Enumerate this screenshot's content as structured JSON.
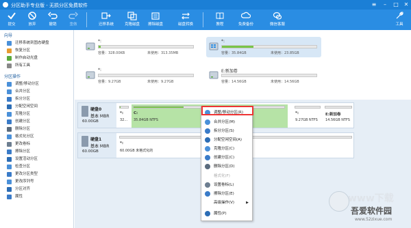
{
  "window": {
    "title": "分区助手专业版 - 无损分区免费软件"
  },
  "toolbar": {
    "buttons": [
      {
        "label": "提交",
        "enabled": true
      },
      {
        "label": "放弃",
        "enabled": true
      },
      {
        "label": "撤销",
        "enabled": true
      },
      {
        "label": "重做",
        "enabled": false
      },
      {
        "label": "迁移系统",
        "enabled": true
      },
      {
        "label": "克隆磁盘",
        "enabled": true
      },
      {
        "label": "擦除磁盘",
        "enabled": true
      },
      {
        "label": "磁盘转换",
        "enabled": true
      },
      {
        "label": "教程",
        "enabled": true
      },
      {
        "label": "免费备份",
        "enabled": true
      },
      {
        "label": "微信客服",
        "enabled": true
      },
      {
        "label": "工具",
        "enabled": true
      }
    ]
  },
  "sidebar": {
    "wizard_heading": "向导",
    "wizard_items": [
      "迁移系统到固态硬盘",
      "恢复分区",
      "制作启动光盘",
      "所有工具"
    ],
    "ops_heading": "分区操作",
    "ops_items": [
      "调整/移动分区",
      "合并分区",
      "拆分分区",
      "分配空闲空间",
      "克隆分区",
      "创建分区",
      "删除分区",
      "格式化分区",
      "更改卷标",
      "擦除分区",
      "设置活动分区",
      "检查分区",
      "更改分区类型",
      "更改序列号",
      "分区对齐",
      "属性"
    ]
  },
  "disk_cards": [
    {
      "label": "*:",
      "capacity": "容量：328.00KB",
      "free": "未使用：313.35MB",
      "fill": 0.02
    },
    {
      "label": "*:",
      "capacity": "容量：35.84GB",
      "free": "未使用：23.85GB",
      "fill": 0.33
    },
    {
      "label": "*:",
      "capacity": "容量：9.27GB",
      "free": "未使用：9.27GB",
      "fill": 0.0
    },
    {
      "label": "E:新加卷",
      "capacity": "容量：14.56GB",
      "free": "未使用：14.56GB",
      "fill": 0.0
    }
  ],
  "disk0": {
    "name": "硬盘0",
    "type": "基本 MBR",
    "size": "60.00GB",
    "partitions": [
      {
        "name": "*:",
        "info": "32...",
        "fill": 0.1
      },
      {
        "name": "C:",
        "info": "35.84GB NTFS",
        "fill": 0.33
      },
      {
        "name": "*:",
        "info": "9.27GB NTFS",
        "fill": 0.0
      },
      {
        "name": "E:新加卷",
        "info": "14.56GB NTFS",
        "fill": 0.0
      }
    ]
  },
  "disk1": {
    "name": "硬盘1",
    "type": "基本 MBR",
    "size": "60.00GB",
    "partitions": [
      {
        "name": "*:",
        "info": "60.00GB 未格式化的"
      }
    ]
  },
  "context_menu": {
    "items": [
      {
        "label": "调整/移动分区(R)",
        "enabled": true,
        "icon": "resize-icon"
      },
      {
        "label": "合并分区(M)",
        "enabled": true,
        "icon": "merge-icon"
      },
      {
        "label": "拆分分区(S)",
        "enabled": true,
        "icon": "split-icon"
      },
      {
        "label": "分配空闲空间(A)",
        "enabled": true,
        "icon": "allocate-icon"
      },
      {
        "label": "克隆分区(C)",
        "enabled": true,
        "icon": "clone-icon"
      },
      {
        "label": "创建分区(C)",
        "enabled": true,
        "icon": "create-icon"
      },
      {
        "label": "删除分区(D)",
        "enabled": true,
        "icon": "delete-icon"
      },
      {
        "label": "格式化(F)",
        "enabled": false,
        "icon": ""
      },
      {
        "label": "设置卷标(L)",
        "enabled": true,
        "icon": "label-icon"
      },
      {
        "label": "擦除分区(E)",
        "enabled": true,
        "icon": "wipe-icon"
      },
      {
        "label": "高级操作(V)",
        "enabled": true,
        "icon": "",
        "submenu": true
      },
      {
        "label": "属性(P)",
        "enabled": true,
        "icon": "info-icon"
      }
    ]
  },
  "watermark": {
    "name": "吾爱软件园",
    "big": "www下载",
    "url": "www.52zixue.com"
  }
}
